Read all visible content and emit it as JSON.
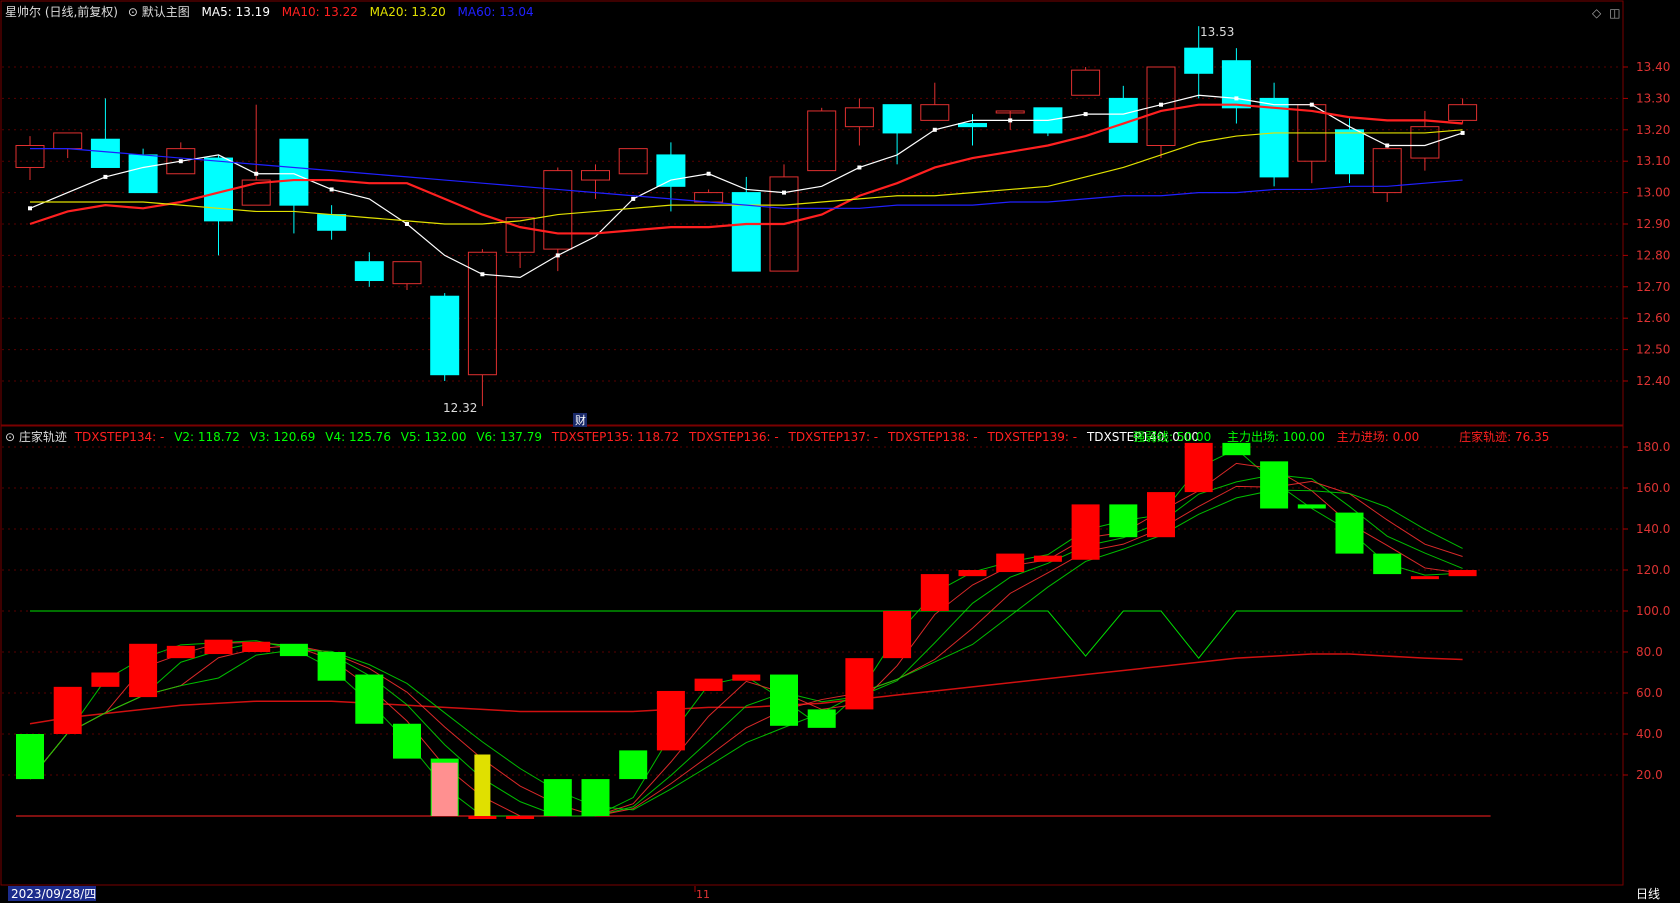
{
  "colors": {
    "bg": "#000000",
    "grid": "#5a0000",
    "up": "#e03030",
    "down": "#00ffff",
    "ma5": "#ffffff",
    "ma10": "#ff2020",
    "ma20": "#e0e000",
    "ma60": "#2020ff",
    "osc_up": "#ff0000",
    "osc_down": "#00ff00",
    "text": "#dddddd"
  },
  "header": {
    "title": "星帅尔 (日线,前复权)",
    "template": "默认主图",
    "ma5": "MA5: 13.19",
    "ma10": "MA10: 13.22",
    "ma20": "MA20: 13.20",
    "ma60": "MA60: 13.04",
    "icons": [
      "diamond-icon",
      "window-icon"
    ]
  },
  "sub_header": {
    "name": "庄家轨迹",
    "s134": "TDXSTEP134: -",
    "v2": "V2: 118.72",
    "v3": "V3: 120.69",
    "v4": "V4: 125.76",
    "v5": "V5: 132.00",
    "v6": "V6: 137.79",
    "s135": "TDXSTEP135: 118.72",
    "s136": "TDXSTEP136: -",
    "s137": "TDXSTEP137: -",
    "s138": "TDXSTEP138: -",
    "s139": "TDXSTEP139: -",
    "s140": "TDXSTEP140: 0.00",
    "strong": "强弱线: 50.00",
    "exit": "主力出场: 100.00",
    "enter": "主力进场: 0.00",
    "track": "庄家轨迹: 76.35"
  },
  "annotations": {
    "high": "13.53",
    "low": "12.32",
    "cai": "财"
  },
  "footer": {
    "date": "2023/09/28/四",
    "month": "11",
    "period": "日线"
  },
  "chart_data": [
    {
      "type": "candlestick",
      "title": "星帅尔 (日线,前复权)",
      "y_ticks": [
        "13.40",
        "13.30",
        "13.20",
        "13.10",
        "13.00",
        "12.90",
        "12.80",
        "12.70",
        "12.60",
        "12.50",
        "12.40"
      ],
      "ylim": [
        12.3,
        13.55
      ],
      "grid": true,
      "ohlc": [
        [
          13.08,
          13.18,
          13.04,
          13.15
        ],
        [
          13.14,
          13.19,
          13.11,
          13.19
        ],
        [
          13.17,
          13.3,
          13.08,
          13.08
        ],
        [
          13.12,
          13.14,
          13.05,
          13.0
        ],
        [
          13.06,
          13.16,
          13.06,
          13.14
        ],
        [
          13.11,
          13.12,
          12.8,
          12.91
        ],
        [
          12.96,
          13.28,
          12.96,
          13.04
        ],
        [
          13.17,
          13.17,
          12.87,
          12.96
        ],
        [
          12.93,
          12.96,
          12.85,
          12.88
        ],
        [
          12.78,
          12.81,
          12.7,
          12.72
        ],
        [
          12.71,
          12.78,
          12.69,
          12.78
        ],
        [
          12.67,
          12.68,
          12.4,
          12.42
        ],
        [
          12.42,
          12.82,
          12.32,
          12.81
        ],
        [
          12.81,
          12.92,
          12.76,
          12.92
        ],
        [
          12.82,
          13.08,
          12.75,
          13.07
        ],
        [
          13.04,
          13.09,
          12.98,
          13.07
        ],
        [
          13.06,
          13.14,
          13.06,
          13.14
        ],
        [
          13.12,
          13.16,
          12.94,
          13.02
        ],
        [
          12.97,
          13.01,
          12.97,
          13.0
        ],
        [
          13.0,
          13.05,
          12.75,
          12.75
        ],
        [
          12.75,
          13.09,
          12.75,
          13.05
        ],
        [
          13.07,
          13.27,
          13.07,
          13.26
        ],
        [
          13.21,
          13.3,
          13.15,
          13.27
        ],
        [
          13.28,
          13.28,
          13.09,
          13.19
        ],
        [
          13.23,
          13.35,
          13.23,
          13.28
        ],
        [
          13.22,
          13.25,
          13.15,
          13.21
        ],
        [
          13.26,
          13.26,
          13.2,
          13.26
        ],
        [
          13.27,
          13.27,
          13.18,
          13.19
        ],
        [
          13.31,
          13.4,
          13.31,
          13.39
        ],
        [
          13.3,
          13.34,
          13.16,
          13.16
        ],
        [
          13.15,
          13.4,
          13.11,
          13.4
        ],
        [
          13.46,
          13.53,
          13.3,
          13.38
        ],
        [
          13.42,
          13.46,
          13.22,
          13.27
        ],
        [
          13.3,
          13.35,
          13.02,
          13.05
        ],
        [
          13.1,
          13.28,
          13.03,
          13.28
        ],
        [
          13.2,
          13.24,
          13.03,
          13.06
        ],
        [
          13.0,
          13.15,
          12.97,
          13.14
        ],
        [
          13.11,
          13.26,
          13.07,
          13.21
        ],
        [
          13.23,
          13.3,
          13.22,
          13.28
        ]
      ],
      "series": [
        {
          "name": "MA5",
          "color": "#ffffff",
          "values": [
            12.95,
            13.0,
            13.05,
            13.08,
            13.1,
            13.12,
            13.06,
            13.06,
            13.01,
            12.98,
            12.9,
            12.8,
            12.74,
            12.73,
            12.8,
            12.86,
            12.98,
            13.04,
            13.06,
            13.01,
            13.0,
            13.02,
            13.08,
            13.12,
            13.2,
            13.23,
            13.23,
            13.23,
            13.25,
            13.25,
            13.28,
            13.31,
            13.3,
            13.28,
            13.28,
            13.21,
            13.15,
            13.15,
            13.19
          ]
        },
        {
          "name": "MA10",
          "color": "#ff2020",
          "values": [
            12.9,
            12.94,
            12.96,
            12.95,
            12.97,
            13.0,
            13.03,
            13.04,
            13.04,
            13.03,
            13.03,
            12.98,
            12.93,
            12.89,
            12.87,
            12.87,
            12.88,
            12.89,
            12.89,
            12.9,
            12.9,
            12.93,
            12.99,
            13.03,
            13.08,
            13.11,
            13.13,
            13.15,
            13.18,
            13.22,
            13.26,
            13.28,
            13.28,
            13.27,
            13.26,
            13.24,
            13.23,
            13.23,
            13.22
          ]
        },
        {
          "name": "MA20",
          "color": "#e0e000",
          "values": [
            12.97,
            12.97,
            12.97,
            12.97,
            12.96,
            12.95,
            12.94,
            12.94,
            12.93,
            12.92,
            12.91,
            12.9,
            12.9,
            12.91,
            12.93,
            12.94,
            12.95,
            12.96,
            12.96,
            12.96,
            12.96,
            12.97,
            12.98,
            12.99,
            12.99,
            13.0,
            13.01,
            13.02,
            13.05,
            13.08,
            13.12,
            13.16,
            13.18,
            13.19,
            13.19,
            13.19,
            13.19,
            13.19,
            13.2
          ]
        },
        {
          "name": "MA60",
          "color": "#2020ff",
          "values": [
            13.14,
            13.14,
            13.13,
            13.12,
            13.11,
            13.1,
            13.09,
            13.08,
            13.07,
            13.06,
            13.05,
            13.04,
            13.03,
            13.02,
            13.01,
            13.0,
            12.99,
            12.98,
            12.97,
            12.96,
            12.95,
            12.95,
            12.95,
            12.96,
            12.96,
            12.96,
            12.97,
            12.97,
            12.98,
            12.99,
            12.99,
            13.0,
            13.0,
            13.01,
            13.01,
            13.02,
            13.02,
            13.03,
            13.04
          ]
        }
      ]
    },
    {
      "type": "bar",
      "title": "庄家轨迹",
      "y_ticks": [
        "180.0",
        "160.0",
        "140.0",
        "120.0",
        "100.0",
        "80.0",
        "60.0",
        "40.0",
        "20.0"
      ],
      "ylim": [
        -2,
        183
      ],
      "bars": [
        [
          40,
          18
        ],
        [
          40,
          63
        ],
        [
          63,
          70
        ],
        [
          58,
          84
        ],
        [
          77,
          83
        ],
        [
          79,
          86
        ],
        [
          80,
          85
        ],
        [
          84,
          78
        ],
        [
          80,
          66
        ],
        [
          69,
          45
        ],
        [
          45,
          28
        ],
        [
          28,
          0
        ],
        [
          0,
          0
        ],
        [
          0,
          0
        ],
        [
          18,
          0
        ],
        [
          18,
          0
        ],
        [
          32,
          18
        ],
        [
          32,
          61
        ],
        [
          61,
          67
        ],
        [
          66,
          69
        ],
        [
          69,
          44
        ],
        [
          52,
          43
        ],
        [
          52,
          77
        ],
        [
          77,
          100
        ],
        [
          100,
          118
        ],
        [
          117,
          120
        ],
        [
          119,
          128
        ],
        [
          124,
          127
        ],
        [
          125,
          152
        ],
        [
          152,
          136
        ],
        [
          136,
          158
        ],
        [
          158,
          182
        ],
        [
          182,
          176
        ],
        [
          173,
          150
        ],
        [
          152,
          150
        ],
        [
          148,
          128
        ],
        [
          128,
          118
        ],
        [
          117,
          117
        ],
        [
          117,
          120
        ]
      ],
      "overlay_bars": [
        {
          "index": 11,
          "from": 0,
          "to": 26,
          "color": "#ff9090"
        },
        {
          "index": 12,
          "from": 0,
          "to": 30,
          "color": "#e0e000"
        }
      ],
      "series": [
        {
          "name": "V2",
          "color": "#ff3030",
          "values": [
            null,
            null,
            null,
            null,
            null,
            null,
            null,
            null,
            null,
            null,
            null,
            null,
            null,
            null,
            null,
            null,
            null,
            null,
            null,
            null,
            null,
            null,
            null,
            null,
            null,
            null,
            null,
            null,
            null,
            null,
            null,
            null,
            null,
            null,
            null,
            null,
            null,
            null,
            118.72
          ]
        },
        {
          "name": "V3",
          "color": "#ff3030",
          "values": [
            null,
            null,
            null,
            null,
            null,
            null,
            null,
            null,
            null,
            null,
            null,
            null,
            null,
            null,
            null,
            null,
            null,
            null,
            null,
            null,
            null,
            null,
            null,
            null,
            null,
            null,
            null,
            null,
            null,
            null,
            null,
            null,
            null,
            null,
            null,
            null,
            null,
            null,
            120.69
          ]
        },
        {
          "name": "V4",
          "color": "#ff3030",
          "values": [
            null,
            null,
            null,
            null,
            null,
            null,
            null,
            null,
            null,
            null,
            null,
            null,
            null,
            null,
            null,
            null,
            null,
            null,
            null,
            null,
            null,
            null,
            null,
            null,
            null,
            null,
            null,
            null,
            null,
            null,
            null,
            null,
            null,
            null,
            null,
            null,
            null,
            null,
            125.76
          ]
        },
        {
          "name": "V5",
          "color": "#ff3030",
          "values": [
            null,
            null,
            null,
            null,
            null,
            null,
            null,
            null,
            null,
            null,
            null,
            null,
            null,
            null,
            null,
            null,
            null,
            null,
            null,
            null,
            null,
            null,
            null,
            null,
            null,
            null,
            null,
            null,
            null,
            null,
            null,
            null,
            null,
            null,
            null,
            null,
            null,
            null,
            132.0
          ]
        },
        {
          "name": "V6",
          "color": "#ff3030",
          "values": [
            null,
            null,
            null,
            null,
            null,
            null,
            null,
            null,
            null,
            null,
            null,
            null,
            null,
            null,
            null,
            null,
            null,
            null,
            null,
            null,
            null,
            null,
            null,
            null,
            null,
            null,
            null,
            null,
            null,
            null,
            null,
            null,
            null,
            null,
            null,
            null,
            null,
            null,
            137.79
          ]
        },
        {
          "name": "主力出场",
          "color": "#00e000",
          "values": [
            100,
            100,
            100,
            100,
            100,
            100,
            100,
            100,
            100,
            100,
            100,
            100,
            100,
            100,
            100,
            100,
            100,
            100,
            100,
            100,
            100,
            100,
            100,
            100,
            100,
            100,
            100,
            100,
            78,
            100,
            100,
            77,
            100,
            100,
            100,
            100,
            100,
            100,
            100
          ]
        },
        {
          "name": "主力进场",
          "color": "#ff2020",
          "values": [
            0,
            0,
            0,
            0,
            0,
            0,
            0,
            0,
            0,
            0,
            0,
            0,
            0,
            0,
            0,
            0,
            0,
            0,
            0,
            0,
            0,
            0,
            0,
            0,
            0,
            0,
            0,
            0,
            0,
            0,
            0,
            0,
            0,
            0,
            0,
            0,
            0,
            0,
            0
          ]
        },
        {
          "name": "庄家轨迹",
          "color": "#d01010",
          "values": [
            45,
            48,
            50,
            52,
            54,
            55,
            56,
            56,
            56,
            55,
            54,
            53,
            52,
            51,
            51,
            51,
            51,
            52,
            53,
            53,
            54,
            55,
            57,
            59,
            61,
            63,
            65,
            67,
            69,
            71,
            73,
            75,
            77,
            78,
            79,
            79,
            78,
            77,
            76.35
          ]
        }
      ]
    }
  ]
}
